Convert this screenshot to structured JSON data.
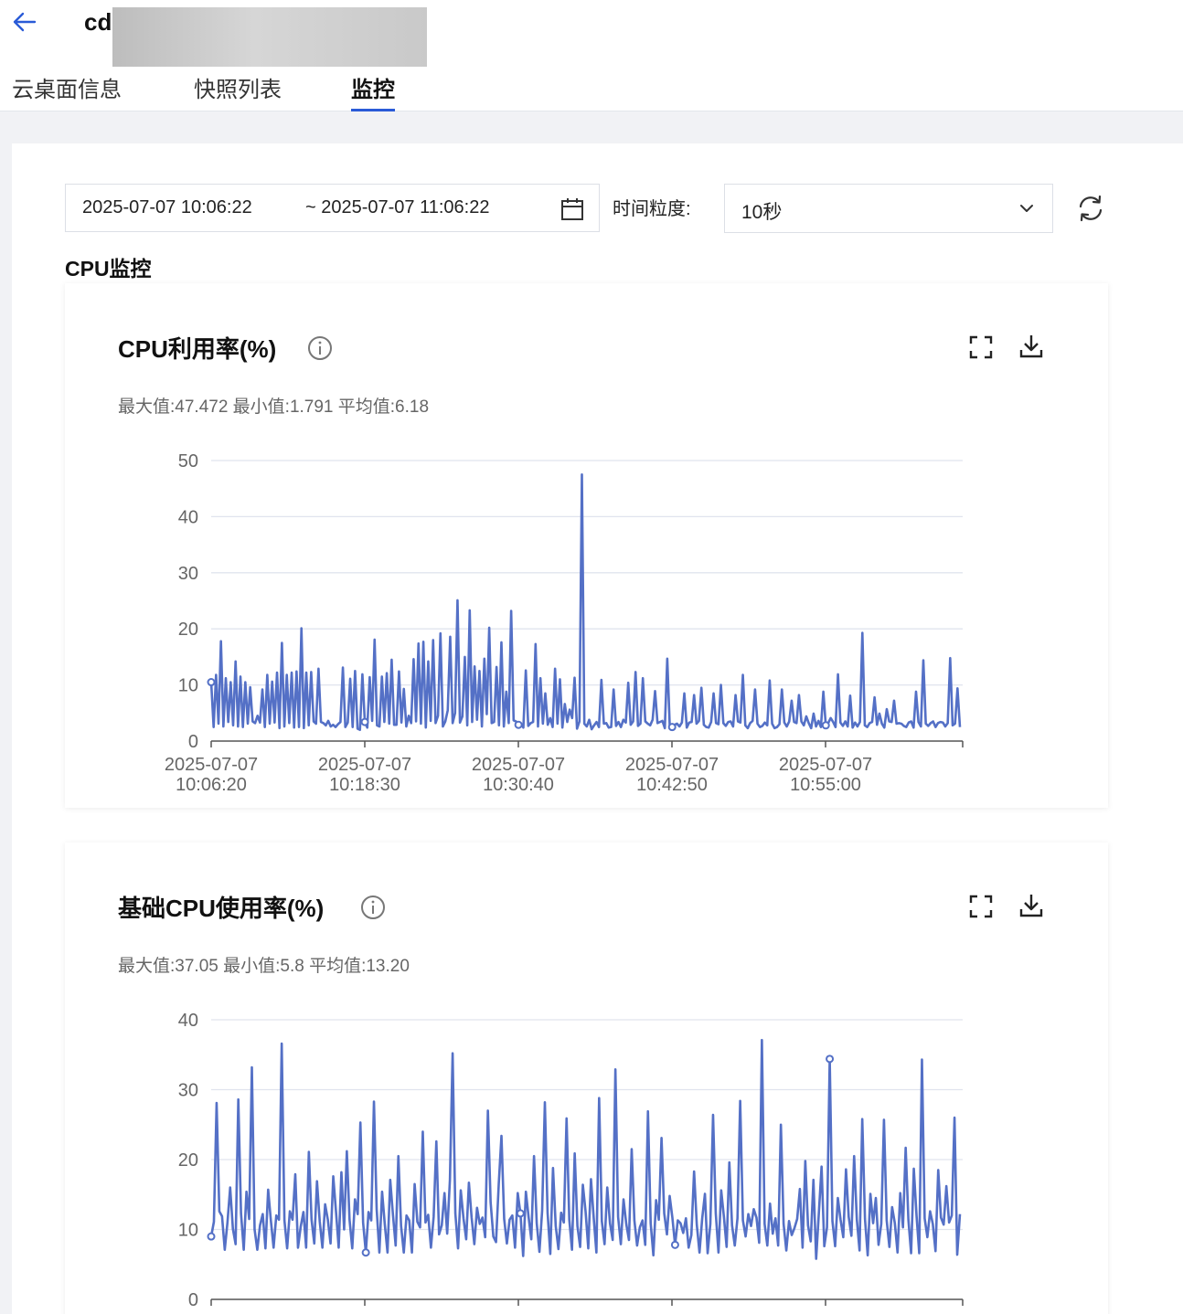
{
  "header": {
    "title": "cd",
    "tabs": [
      {
        "label": "云桌面信息",
        "active": false
      },
      {
        "label": "快照列表",
        "active": false
      },
      {
        "label": "监控",
        "active": true
      }
    ]
  },
  "filters": {
    "start_time": "2025-07-07 10:06:22",
    "end_time": "~ 2025-07-07 11:06:22",
    "granularity_label": "时间粒度:",
    "granularity_value": "10秒"
  },
  "section_title": "CPU监控",
  "colors": {
    "accent": "#2a5bd7",
    "series": "#5470c6"
  },
  "chart_data": [
    {
      "type": "line",
      "title": "CPU利用率(%)",
      "stats": "最大值:47.472 最小值:1.791 平均值:6.18",
      "ylim": [
        0,
        50
      ],
      "yticks": [
        "0",
        "10",
        "20",
        "30",
        "40",
        "50"
      ],
      "xticks": [
        {
          "date": "2025-07-07",
          "time": "10:06:20"
        },
        {
          "date": "2025-07-07",
          "time": "10:18:30"
        },
        {
          "date": "2025-07-07",
          "time": "10:30:40"
        },
        {
          "date": "2025-07-07",
          "time": "10:42:50"
        },
        {
          "date": "2025-07-07",
          "time": "10:55:00"
        }
      ],
      "grid": true,
      "x_start": "2025-07-07 10:06:20",
      "x_interval_seconds": 10,
      "series": [
        {
          "values": [
            10.5,
            2.5,
            11.8,
            3.1,
            17.8,
            2.6,
            11.2,
            3.4,
            10.5,
            2.8,
            14.2,
            2.6,
            11.5,
            2.5,
            10.5,
            3.1,
            9.6,
            3.5,
            3.2,
            4.5,
            3.3,
            9.2,
            2.5,
            11.8,
            3.1,
            10.6,
            3.3,
            12.2,
            2.3,
            17.5,
            2.6,
            11.8,
            3.2,
            12.2,
            2.4,
            12.4,
            2.5,
            20.1,
            2.3,
            12.2,
            2.8,
            12.3,
            3.5,
            3.1,
            12.9,
            3.4,
            3.2,
            2.8,
            3.6,
            2.6,
            2.9,
            2.5,
            3.0,
            3.4,
            13.1,
            2.5,
            3.3,
            11.1,
            2.5,
            12.5,
            2.2,
            2.0,
            11.9,
            3.4,
            2.4,
            11.4,
            3.6,
            18.1,
            2.8,
            2.6,
            11.5,
            3.4,
            12.1,
            3.1,
            14.5,
            2.9,
            2.9,
            12.4,
            3.3,
            9.3,
            2.6,
            4.5,
            3.2,
            14.6,
            3.5,
            17.4,
            3.1,
            17.7,
            2.4,
            14.2,
            3.6,
            18.0,
            3.2,
            4.5,
            19.2,
            2.6,
            3.5,
            5.5,
            18.6,
            3.2,
            5.0,
            25.1,
            3.3,
            4.4,
            15.0,
            2.8,
            23.3,
            3.4,
            13.3,
            3.8,
            12.5,
            2.6,
            14.7,
            4.8,
            20.2,
            3.2,
            3.4,
            13.2,
            2.8,
            17.6,
            2.6,
            8.8,
            3.2,
            23.2,
            3.7,
            3.5,
            2.9,
            3.1,
            2.4,
            12.6,
            2.7,
            3.2,
            3.4,
            17.3,
            2.6,
            11.2,
            3.1,
            8.5,
            2.9,
            4.1,
            2.5,
            12.9,
            3.1,
            11.0,
            2.4,
            6.6,
            3.4,
            5.6,
            4.1,
            11.3,
            2.2,
            3.5,
            47.5,
            3.1,
            2.6,
            3.8,
            2.1,
            2.8,
            3.4,
            2.5,
            10.9,
            3.1,
            3.2,
            2.4,
            2.5,
            9.2,
            2.7,
            3.4,
            2.5,
            3.8,
            3.3,
            10.4,
            2.9,
            3.5,
            12.3,
            2.7,
            3.1,
            11.2,
            3.5,
            3.1,
            2.8,
            3.8,
            8.9,
            3.2,
            3.4,
            3.6,
            2.3,
            14.7,
            2.9,
            2.5,
            2.9,
            3.1,
            2.6,
            3.3,
            8.5,
            2.4,
            3.3,
            3.4,
            8.2,
            3.1,
            3.6,
            9.5,
            2.9,
            2.5,
            2.4,
            3.4,
            8.5,
            3.2,
            3.0,
            10.0,
            3.2,
            2.7,
            3.4,
            3.5,
            2.6,
            8.2,
            3.5,
            3.3,
            11.8,
            2.8,
            2.3,
            3.2,
            3.6,
            9.2,
            3.1,
            2.5,
            2.7,
            3.3,
            2.8,
            10.8,
            3.1,
            2.3,
            2.5,
            3.0,
            9.2,
            3.3,
            2.6,
            3.5,
            7.2,
            3.4,
            3.2,
            8.2,
            3.5,
            2.8,
            4.4,
            3.2,
            2.3,
            4.9,
            2.6,
            3.6,
            2.5,
            8.8,
            2.8,
            3.2,
            4.1,
            3.4,
            2.5,
            11.9,
            3.3,
            2.7,
            3.5,
            2.6,
            8.1,
            2.4,
            3.3,
            2.6,
            3.4,
            19.3,
            2.8,
            2.5,
            3.2,
            3.4,
            7.8,
            2.9,
            4.9,
            3.1,
            2.4,
            5.7,
            3.5,
            3.4,
            7.2,
            3.1,
            3.2,
            3.1,
            2.7,
            2.5,
            3.3,
            3.5,
            2.4,
            8.8,
            3.4,
            2.6,
            14.4,
            3.1,
            2.7,
            3.2,
            3.5,
            2.5,
            3.2,
            3.4,
            3.3,
            2.6,
            3.2,
            14.8,
            2.8,
            3.1,
            9.4,
            2.5
          ]
        }
      ]
    },
    {
      "type": "line",
      "title": "基础CPU使用率(%)",
      "stats": "最大值:37.05 最小值:5.8 平均值:13.20",
      "ylim": [
        0,
        40
      ],
      "yticks": [
        "0",
        "10",
        "20",
        "30",
        "40"
      ],
      "grid": true,
      "x_start": "2025-07-07 10:06:20",
      "x_interval_seconds": 10,
      "series": [
        {
          "values": [
            9.0,
            11.1,
            28.1,
            12.6,
            11.9,
            7.1,
            11.0,
            16.0,
            10.1,
            7.9,
            28.6,
            12.3,
            7.1,
            15.4,
            11.5,
            33.2,
            10.0,
            7.1,
            10.6,
            12.2,
            7.3,
            15.7,
            11.3,
            7.4,
            12.0,
            11.4,
            36.6,
            11.3,
            7.3,
            12.6,
            11.4,
            17.9,
            7.4,
            10.4,
            12.5,
            7.4,
            21.1,
            11.4,
            8.0,
            16.9,
            11.2,
            7.4,
            13.6,
            11.4,
            8.0,
            17.6,
            12.6,
            7.4,
            18.2,
            10.0,
            21.2,
            11.4,
            7.3,
            14.3,
            12.2,
            25.3,
            11.0,
            6.7,
            12.5,
            11.3,
            28.3,
            12.9,
            6.7,
            15.4,
            10.7,
            6.7,
            17.1,
            12.1,
            7.7,
            20.5,
            10.5,
            6.7,
            12.0,
            11.3,
            6.7,
            16.5,
            11.1,
            10.3,
            24.0,
            11.0,
            12.1,
            7.4,
            11.8,
            22.6,
            9.3,
            10.6,
            15.2,
            9.4,
            17.1,
            35.2,
            12.3,
            7.3,
            15.6,
            11.6,
            8.6,
            16.7,
            11.7,
            7.9,
            13.1,
            10.8,
            11.7,
            8.9,
            27.0,
            13.9,
            9.0,
            8.2,
            16.5,
            23.4,
            11.5,
            8.0,
            11.4,
            12.0,
            7.4,
            15.2,
            12.3,
            6.2,
            15.4,
            11.8,
            8.6,
            20.5,
            10.9,
            6.8,
            12.7,
            28.2,
            12.4,
            6.5,
            18.8,
            10.5,
            7.2,
            12.4,
            11.0,
            25.9,
            11.4,
            7.1,
            20.9,
            10.5,
            7.5,
            16.4,
            12.6,
            7.3,
            17.2,
            11.7,
            6.7,
            28.8,
            11.2,
            7.9,
            16.0,
            10.9,
            8.5,
            32.9,
            11.8,
            7.9,
            14.3,
            10.8,
            8.5,
            21.5,
            11.3,
            7.7,
            10.3,
            11.3,
            7.8,
            26.9,
            10.9,
            6.3,
            14.2,
            11.4,
            23.1,
            12.3,
            9.3,
            14.8,
            11.7,
            7.8,
            11.3,
            10.9,
            9.5,
            11.6,
            7.4,
            9.2,
            18.3,
            10.7,
            6.7,
            11.6,
            15.1,
            6.6,
            10.8,
            26.4,
            12.3,
            6.7,
            15.6,
            11.8,
            7.5,
            19.6,
            10.6,
            7.7,
            11.6,
            28.4,
            11.3,
            9.0,
            12.2,
            10.5,
            12.9,
            11.7,
            8.1,
            37.1,
            10.8,
            7.7,
            13.7,
            9.4,
            11.6,
            7.7,
            25.0,
            10.8,
            7.0,
            11.2,
            9.2,
            10.2,
            11.5,
            15.8,
            7.4,
            19.8,
            10.6,
            8.3,
            17.1,
            5.8,
            12.4,
            19.0,
            7.6,
            10.3,
            34.4,
            11.2,
            7.6,
            14.5,
            11.4,
            8.9,
            18.6,
            11.8,
            9.1,
            20.5,
            11.4,
            7.0,
            25.8,
            11.5,
            6.3,
            15.1,
            10.9,
            14.5,
            7.8,
            10.8,
            25.7,
            11.3,
            7.5,
            13.2,
            10.9,
            6.7,
            15.2,
            10.3,
            21.7,
            11.4,
            6.6,
            18.7,
            12.0,
            6.6,
            34.3,
            11.6,
            8.9,
            12.6,
            10.8,
            6.9,
            18.5,
            11.7,
            10.7,
            16.2,
            11.0,
            12.0,
            26.0,
            6.4,
            12.2
          ]
        }
      ]
    }
  ],
  "icons": {
    "back": "arrow-left-icon",
    "calendar": "calendar-icon",
    "dropdown": "chevron-down-icon",
    "refresh": "refresh-icon",
    "info": "info-icon",
    "fullscreen": "fullscreen-icon",
    "download": "download-icon"
  }
}
